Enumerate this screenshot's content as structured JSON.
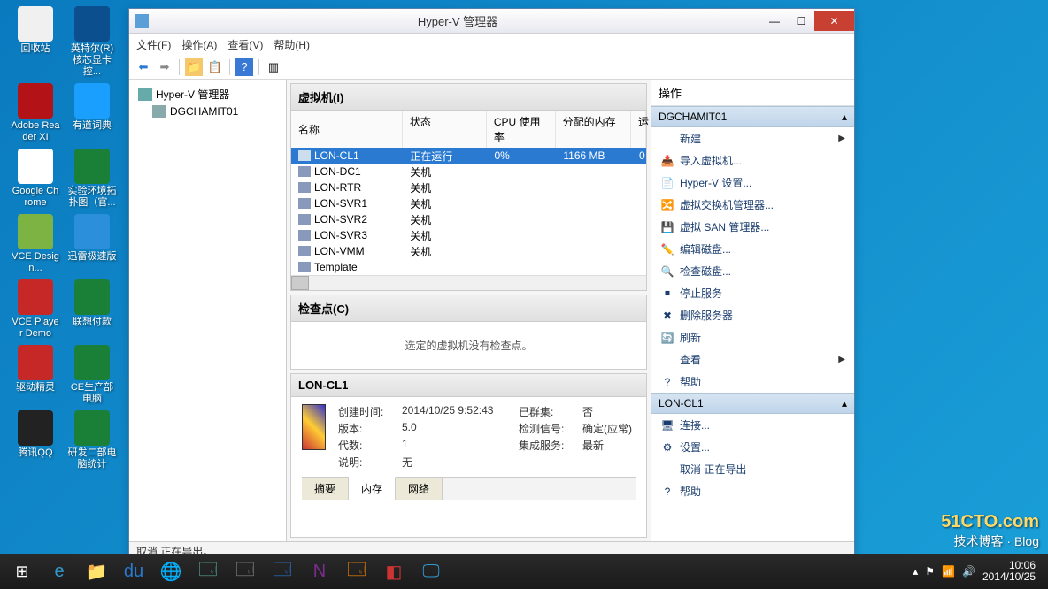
{
  "desktop": {
    "icons": [
      [
        {
          "label": "回收站",
          "color": "#f0f0f0"
        },
        {
          "label": "英特尔(R) 核芯显卡控...",
          "color": "#0b4f8e"
        }
      ],
      [
        {
          "label": "Adobe Reader XI",
          "color": "#b31217"
        },
        {
          "label": "有道词典",
          "color": "#1a9fff"
        }
      ],
      [
        {
          "label": "Google Chrome",
          "color": "#fff"
        },
        {
          "label": "实验环境拓扑图（官...",
          "color": "#1a7f37"
        }
      ],
      [
        {
          "label": "VCE Design...",
          "color": "#7cb342"
        },
        {
          "label": "迅雷极速版",
          "color": "#2c8fdb"
        }
      ],
      [
        {
          "label": "VCE Player Demo",
          "color": "#c62828"
        },
        {
          "label": "联想付款",
          "color": "#1a7f37"
        }
      ],
      [
        {
          "label": "驱动精灵",
          "color": "#c62828"
        },
        {
          "label": "CE生产部电脑",
          "color": "#1a7f37"
        }
      ],
      [
        {
          "label": "腾讯QQ",
          "color": "#222"
        },
        {
          "label": "研发二部电脑统计",
          "color": "#1a7f37"
        }
      ]
    ]
  },
  "window": {
    "title": "Hyper-V 管理器",
    "menu": [
      "文件(F)",
      "操作(A)",
      "查看(V)",
      "帮助(H)"
    ],
    "tree": {
      "root": "Hyper-V 管理器",
      "child": "DGCHAMIT01"
    },
    "vms": {
      "header": "虚拟机(I)",
      "cols": {
        "name": "名称",
        "state": "状态",
        "cpu": "CPU 使用率",
        "mem": "分配的内存",
        "up": "运"
      },
      "rows": [
        {
          "name": "LON-CL1",
          "state": "正在运行",
          "cpu": "0%",
          "mem": "1166 MB",
          "selected": true
        },
        {
          "name": "LON-DC1",
          "state": "关机",
          "cpu": "",
          "mem": ""
        },
        {
          "name": "LON-RTR",
          "state": "关机",
          "cpu": "",
          "mem": ""
        },
        {
          "name": "LON-SVR1",
          "state": "关机",
          "cpu": "",
          "mem": ""
        },
        {
          "name": "LON-SVR2",
          "state": "关机",
          "cpu": "",
          "mem": ""
        },
        {
          "name": "LON-SVR3",
          "state": "关机",
          "cpu": "",
          "mem": ""
        },
        {
          "name": "LON-VMM",
          "state": "关机",
          "cpu": "",
          "mem": ""
        },
        {
          "name": "Template",
          "state": "",
          "cpu": "",
          "mem": ""
        }
      ]
    },
    "checkpoints": {
      "header": "检查点(C)",
      "empty": "选定的虚拟机没有检查点。"
    },
    "details": {
      "header": "LON-CL1",
      "created_k": "创建时间:",
      "created_v": "2014/10/25 9:52:43",
      "cluster_k": "已群集:",
      "cluster_v": "否",
      "version_k": "版本:",
      "version_v": "5.0",
      "signal_k": "检测信号:",
      "signal_v": "确定(应常)",
      "gen_k": "代数:",
      "gen_v": "1",
      "svc_k": "集成服务:",
      "svc_v": "最新",
      "note_k": "说明:",
      "note_v": "无",
      "tabs": [
        "摘要",
        "内存",
        "网络"
      ]
    },
    "actions": {
      "title": "操作",
      "section1": "DGCHAMIT01",
      "items1": [
        {
          "label": "新建",
          "arrow": true,
          "ico": ""
        },
        {
          "label": "导入虚拟机...",
          "ico": "📥"
        },
        {
          "label": "Hyper-V 设置...",
          "ico": "📄"
        },
        {
          "label": "虚拟交换机管理器...",
          "ico": "🔀"
        },
        {
          "label": "虚拟 SAN 管理器...",
          "ico": "💾"
        },
        {
          "label": "编辑磁盘...",
          "ico": "✏️"
        },
        {
          "label": "检查磁盘...",
          "ico": "🔍"
        },
        {
          "label": "停止服务",
          "ico": "⏹"
        },
        {
          "label": "删除服务器",
          "ico": "✖"
        },
        {
          "label": "刷新",
          "ico": "🔄"
        },
        {
          "label": "查看",
          "arrow": true,
          "ico": ""
        },
        {
          "label": "帮助",
          "ico": "?"
        }
      ],
      "section2": "LON-CL1",
      "items2": [
        {
          "label": "连接...",
          "ico": "🖥"
        },
        {
          "label": "设置...",
          "ico": "⚙"
        },
        {
          "label": "取消 正在导出",
          "ico": ""
        },
        {
          "label": "帮助",
          "ico": "?"
        }
      ]
    },
    "status": "取消 正在导出。"
  },
  "taskbar": {
    "tray_time": "10:06",
    "tray_date": "2014/10/25"
  },
  "watermark": {
    "line1": "51CTO.com",
    "line2": "技术博客 · Blog"
  }
}
